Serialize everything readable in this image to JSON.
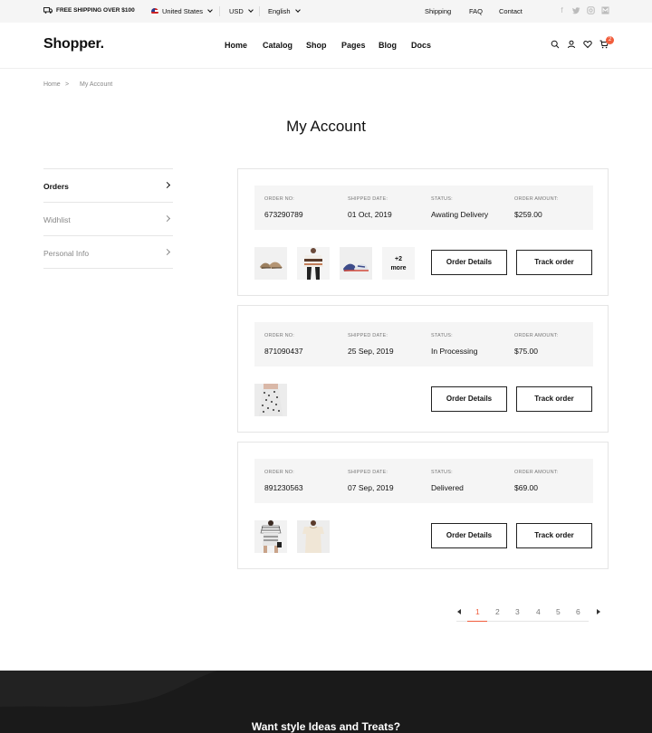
{
  "topbar": {
    "shipping_note": "FREE SHIPPING OVER $100",
    "country": "United States",
    "currency": "USD",
    "language": "English",
    "links": [
      "Shipping",
      "FAQ",
      "Contact"
    ]
  },
  "header": {
    "logo": "Shopper.",
    "nav": [
      "Home",
      "Catalog",
      "Shop",
      "Pages",
      "Blog",
      "Docs"
    ],
    "cart_count": "2"
  },
  "breadcrumb": {
    "home": "Home",
    "separator": ">",
    "current": "My Account"
  },
  "page_title": "My Account",
  "sidebar": {
    "items": [
      {
        "label": "Orders",
        "active": true
      },
      {
        "label": "Widhlist",
        "active": false
      },
      {
        "label": "Personal Info",
        "active": false
      }
    ]
  },
  "labels": {
    "order_no": "ORDER NO:",
    "shipped_date": "SHIPPED DATE:",
    "status": "STATUS:",
    "order_amount": "ORDER AMOUNT:",
    "order_details": "Order Details",
    "track_order": "Track order"
  },
  "orders": [
    {
      "number": "673290789",
      "date": "01 Oct, 2019",
      "status": "Awating Delivery",
      "amount": "$259.00",
      "more_count": "+2",
      "more_label": "more"
    },
    {
      "number": "871090437",
      "date": "25 Sep, 2019",
      "status": "In Processing",
      "amount": "$75.00"
    },
    {
      "number": "891230563",
      "date": "07 Sep, 2019",
      "status": "Delivered",
      "amount": "$69.00"
    }
  ],
  "pagination": {
    "pages": [
      "1",
      "2",
      "3",
      "4",
      "5",
      "6"
    ],
    "current": "1",
    "accent": "#f15d3c"
  },
  "footer": {
    "title": "Want style Ideas and Treats?"
  }
}
